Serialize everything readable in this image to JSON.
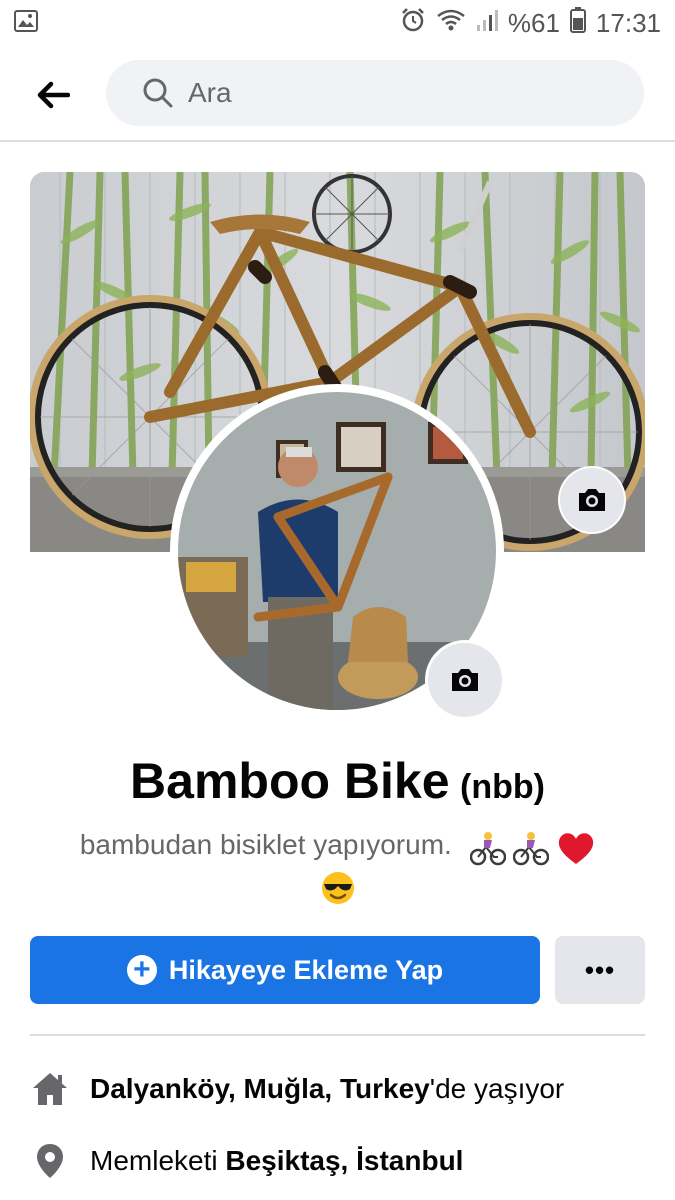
{
  "status_bar": {
    "battery_percent": "%61",
    "time": "17:31",
    "icons": [
      "gallery-icon",
      "alarm-icon",
      "wifi-icon",
      "signal-icon",
      "battery-icon"
    ]
  },
  "header": {
    "search_placeholder": "Ara"
  },
  "profile": {
    "name": "Bamboo Bike",
    "alternate_name": "(nbb)",
    "bio": "bambudan bisiklet yapıyorum.",
    "bio_emojis": [
      "woman-biking-emoji",
      "woman-biking-emoji",
      "red-heart-emoji",
      "sunglasses-face-emoji"
    ]
  },
  "actions": {
    "add_story_label": "Hikayeye Ekleme Yap",
    "more_label": "•••"
  },
  "details": {
    "lives_in": {
      "place": "Dalyanköy, Muğla, Turkey",
      "suffix": "'de yaşıyor"
    },
    "from": {
      "prefix": "Memleketi ",
      "place": "Beşiktaş, İstanbul"
    }
  },
  "colors": {
    "primary": "#1b74e4",
    "secondary_button": "#e4e6eb",
    "search_bg": "#f0f2f5",
    "muted_text": "#65676b"
  }
}
